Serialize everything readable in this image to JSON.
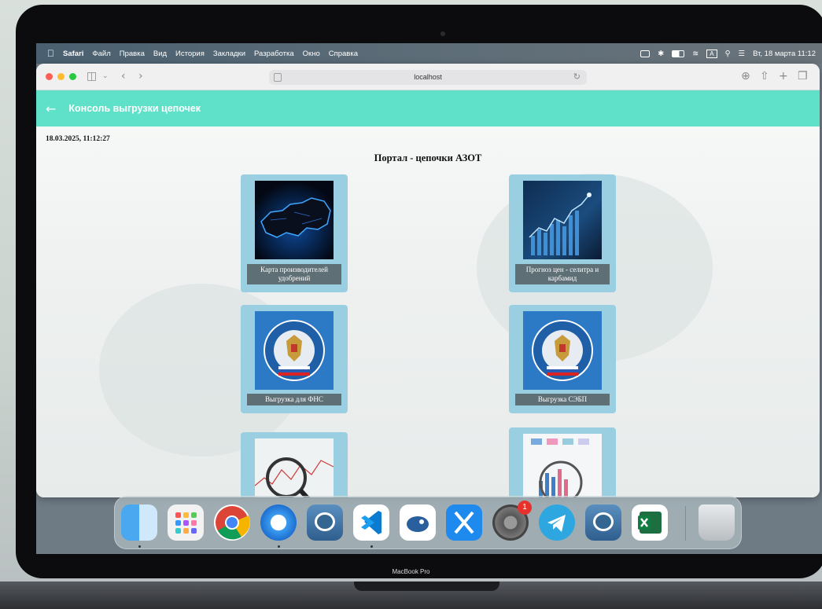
{
  "menubar": {
    "app": "Safari",
    "items": [
      "Файл",
      "Правка",
      "Вид",
      "История",
      "Закладки",
      "Разработка",
      "Окно",
      "Справка"
    ],
    "datetime": "Вт, 18 марта 11:12",
    "input_indicator": "A"
  },
  "browser": {
    "url": "localhost"
  },
  "app": {
    "title": "Консоль выгрузки цепочек",
    "timestamp": "18.03.2025, 11:12:27",
    "page_title": "Портал - цепочки АЗОТ",
    "cards": [
      {
        "label": "Карта производителей удобрений",
        "icon": "map-icon"
      },
      {
        "label": "Прогноз цен - селитра и карбамид",
        "icon": "forecast-chart-icon"
      },
      {
        "label": "Выгрузка для ФНС",
        "icon": "fns-emblem-icon"
      },
      {
        "label": "Выгрузка СЭБП",
        "icon": "fns-emblem-icon"
      },
      {
        "label": "",
        "icon": "magnifier-chart-icon"
      },
      {
        "label": "",
        "icon": "analytics-chart-icon"
      }
    ]
  },
  "dock": {
    "apps": [
      "Finder",
      "Launchpad",
      "Chrome",
      "Safari",
      "pgAdmin",
      "VS Code",
      "DBeaver",
      "Xcode",
      "System Settings",
      "Telegram",
      "pgAdmin",
      "Excel",
      "Trash"
    ],
    "settings_badge": "1"
  },
  "laptop": {
    "brand": "MacBook Pro"
  },
  "colors": {
    "appbar": "#5fe0c9",
    "card": "#9acfe1",
    "card_label": "#5f6f76"
  }
}
